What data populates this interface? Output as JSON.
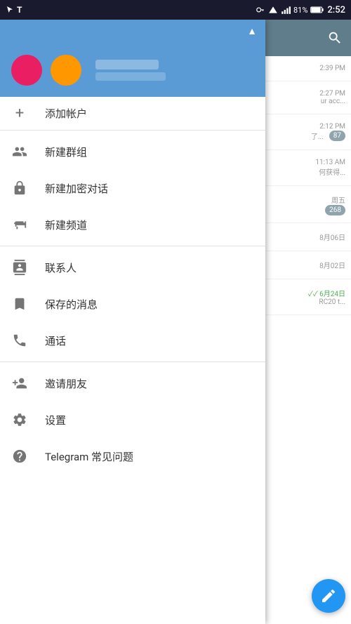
{
  "statusBar": {
    "battery": "81%",
    "time": "2:52"
  },
  "rightPanel": {
    "chatItems": [
      {
        "time": "2:39 PM",
        "preview": "",
        "badge": ""
      },
      {
        "time": "2:27 PM",
        "preview": "ur acc...",
        "badge": ""
      },
      {
        "time": "2:12 PM",
        "preview": "了...",
        "badge": "87"
      },
      {
        "time": "11:13 AM",
        "preview": "何获得...",
        "badge": ""
      },
      {
        "time": "周五",
        "preview": "",
        "badge": "268"
      },
      {
        "time": "8月06日",
        "preview": "",
        "badge": ""
      },
      {
        "time": "8月02日",
        "preview": "",
        "badge": ""
      },
      {
        "time": "6月24日",
        "preview": "RC20 t...",
        "badge": ""
      }
    ]
  },
  "drawer": {
    "addAccountLabel": "添加帐户",
    "menuItems": [
      {
        "id": "new-group",
        "label": "新建群组",
        "icon": "group"
      },
      {
        "id": "new-secret",
        "label": "新建加密对话",
        "icon": "lock"
      },
      {
        "id": "new-channel",
        "label": "新建频道",
        "icon": "megaphone"
      },
      {
        "id": "contacts",
        "label": "联系人",
        "icon": "contacts"
      },
      {
        "id": "saved",
        "label": "保存的消息",
        "icon": "bookmark"
      },
      {
        "id": "calls",
        "label": "通话",
        "icon": "phone"
      },
      {
        "id": "invite",
        "label": "邀请朋友",
        "icon": "person-add"
      },
      {
        "id": "settings",
        "label": "设置",
        "icon": "settings"
      },
      {
        "id": "faq",
        "label": "Telegram 常见问题",
        "icon": "help"
      }
    ]
  }
}
